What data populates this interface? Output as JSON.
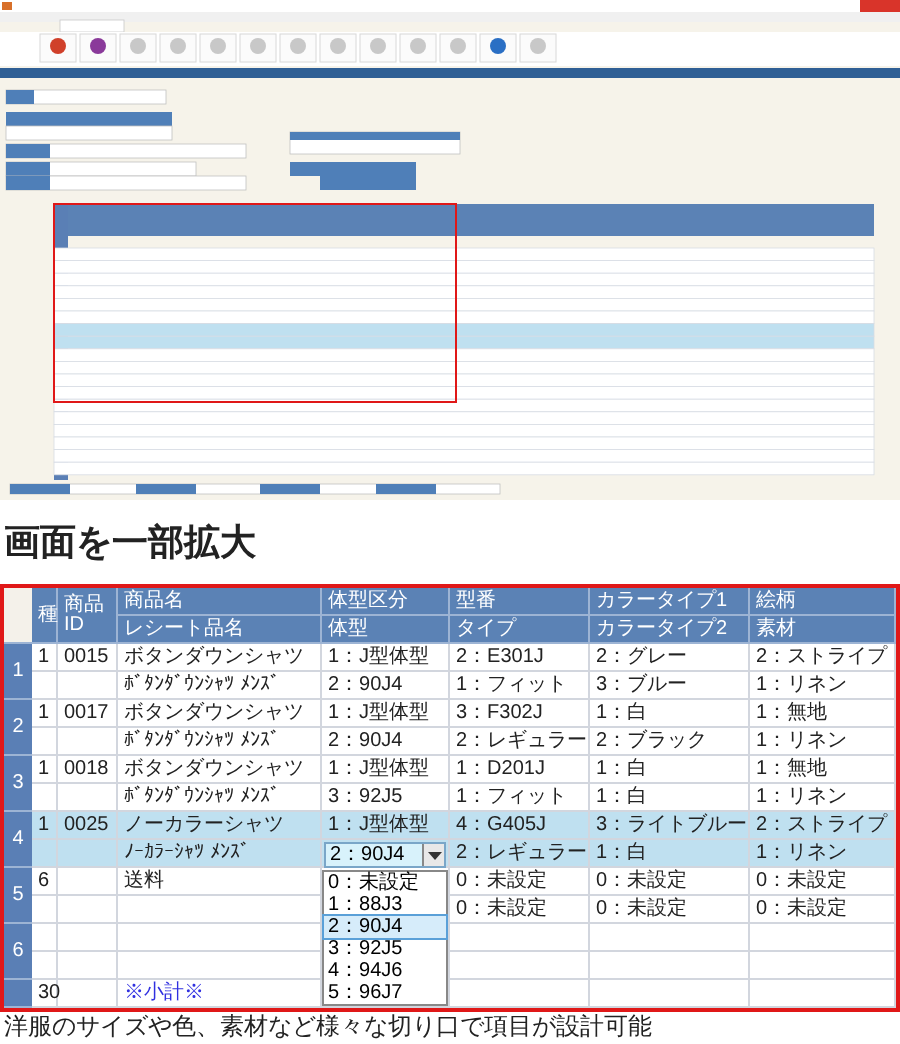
{
  "heading": "画面を一部拡大",
  "table": {
    "header_top": [
      "商品名",
      "体型区分",
      "型番",
      "カラータイプ1",
      "絵柄"
    ],
    "header_bottom": [
      "レシート品名",
      "体型",
      "タイプ",
      "カラータイプ2",
      "素材"
    ],
    "header_span": [
      "種",
      "商品ID"
    ],
    "groups": [
      {
        "label": "1",
        "kind": "item",
        "selected": false,
        "lines": [
          {
            "type": "1",
            "product_id": "0015",
            "name": "ボタンダウンシャツ",
            "body_class": "1：J型体型",
            "model_no": "2：E301J",
            "color_type_1": "2：グレー",
            "pattern": "2：ストライプ"
          },
          {
            "name": "ﾎﾞﾀﾝﾀﾞｳﾝｼｬﾂ ﾒﾝｽﾞ",
            "body_class": "2：90J4",
            "model_no": "1：フィット",
            "color_type_1": "3：ブルー",
            "pattern": "1：リネン"
          }
        ]
      },
      {
        "label": "2",
        "kind": "item",
        "selected": false,
        "lines": [
          {
            "type": "1",
            "product_id": "0017",
            "name": "ボタンダウンシャツ",
            "body_class": "1：J型体型",
            "model_no": "3：F302J",
            "color_type_1": "1：白",
            "pattern": "1：無地"
          },
          {
            "name": "ﾎﾞﾀﾝﾀﾞｳﾝｼｬﾂ ﾒﾝｽﾞ",
            "body_class": "2：90J4",
            "model_no": "2：レギュラー",
            "color_type_1": "2：ブラック",
            "pattern": "1：リネン"
          }
        ]
      },
      {
        "label": "3",
        "kind": "item",
        "selected": false,
        "lines": [
          {
            "type": "1",
            "product_id": "0018",
            "name": "ボタンダウンシャツ",
            "body_class": "1：J型体型",
            "model_no": "1：D201J",
            "color_type_1": "1：白",
            "pattern": "1：無地"
          },
          {
            "name": "ﾎﾞﾀﾝﾀﾞｳﾝｼｬﾂ ﾒﾝｽﾞ",
            "body_class": "3：92J5",
            "model_no": "1：フィット",
            "color_type_1": "1：白",
            "pattern": "1：リネン"
          }
        ]
      },
      {
        "label": "4",
        "kind": "item",
        "selected": true,
        "lines": [
          {
            "type": "1",
            "product_id": "0025",
            "name": "ノーカラーシャツ",
            "body_class": "1：J型体型",
            "model_no": "4：G405J",
            "color_type_1": "3：ライトブルー",
            "pattern": "2：ストライプ"
          },
          {
            "name": "ﾉｰｶﾗｰｼｬﾂ ﾒﾝｽﾞ",
            "select": {
              "value": "2：90J4",
              "options": [
                {
                  "label": "0：未設定",
                  "selected": false
                },
                {
                  "label": "1：88J3",
                  "selected": false
                },
                {
                  "label": "2：90J4",
                  "selected": true
                },
                {
                  "label": "3：92J5",
                  "selected": false
                },
                {
                  "label": "4：94J6",
                  "selected": false
                },
                {
                  "label": "5：96J7",
                  "selected": false
                }
              ]
            },
            "model_no": "2：レギュラー",
            "color_type_1": "1：白",
            "pattern": "1：リネン"
          }
        ]
      },
      {
        "label": "5",
        "kind": "item",
        "selected": false,
        "lines": [
          {
            "type": "6",
            "name": "送料",
            "model_no": "0：未設定",
            "color_type_1": "0：未設定",
            "pattern": "0：未設定"
          },
          {
            "model_no": "0：未設定",
            "color_type_1": "0：未設定",
            "pattern": "0：未設定"
          }
        ]
      },
      {
        "label": "6",
        "kind": "blank",
        "selected": false
      },
      {
        "kind": "subtotal",
        "selected": false,
        "lines": [
          {
            "type": "30",
            "name": "※小計※"
          }
        ]
      }
    ]
  },
  "caption": "洋服のサイズや色、素材など様々な切り口で項目が設計可能"
}
